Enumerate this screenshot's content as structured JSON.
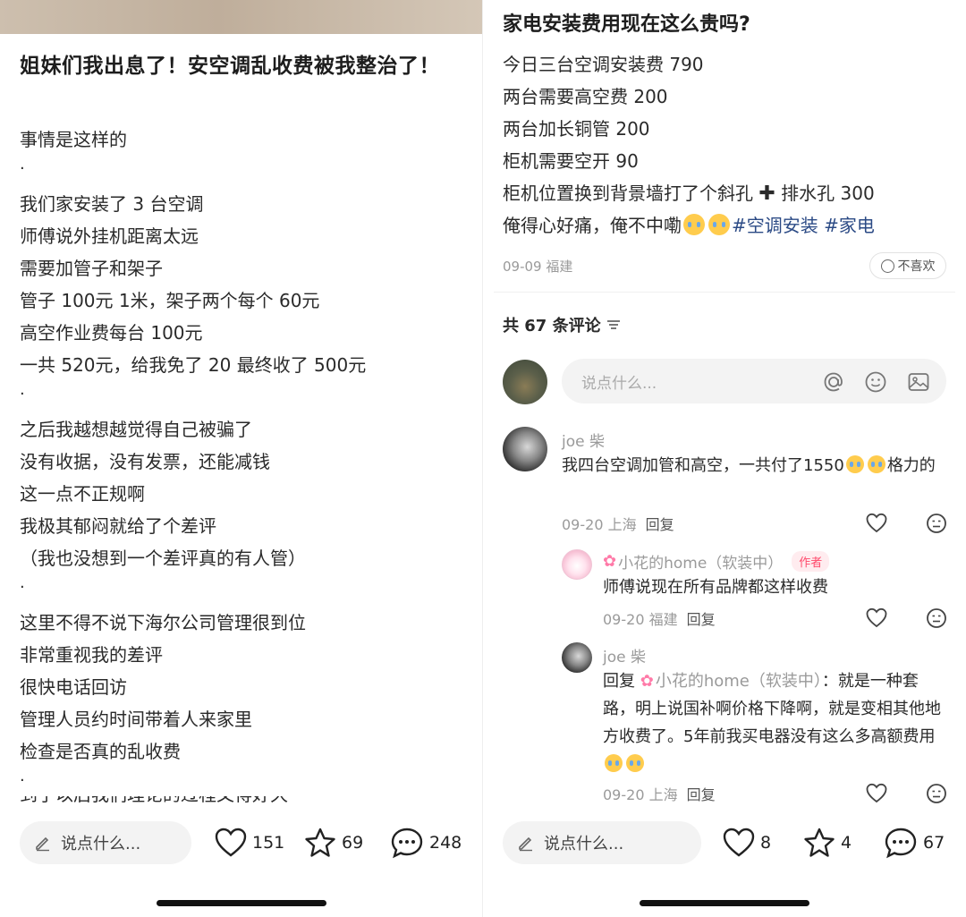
{
  "left": {
    "title": "姐妹们我出息了！安空调乱收费被我整治了！",
    "lines": [
      "事情是这样的",
      "·",
      "我们家安装了 3 台空调",
      "师傅说外挂机距离太远",
      "需要加管子和架子",
      "管子 100元 1米，架子两个每个 60元",
      "高空作业费每台 100元",
      "一共 520元，给我免了 20 最终收了 500元",
      "·",
      "之后我越想越觉得自己被骗了",
      "没有收据，没有发票，还能减钱",
      "这一点不正规啊",
      "我极其郁闷就给了个差评",
      "（我也没想到一个差评真的有人管）",
      "·",
      "这里不得不说下海尔公司管理很到位",
      "非常重视我的差评",
      "很快电话回访",
      "管理人员约时间带着人来家里",
      "检查是否真的乱收费",
      "·"
    ],
    "cut_line": "到了以后我们理论的过程又得好久",
    "bottom": {
      "comment_placeholder": "说点什么...",
      "likes": "151",
      "stars": "69",
      "comments": "248"
    }
  },
  "right": {
    "title": "家电安装费用现在这么贵吗?",
    "lines": [
      "今日三台空调安装费 790",
      "两台需要高空费 200",
      "两台加长铜管 200",
      "柜机需要空开 90"
    ],
    "line5_a": "柜机位置换到背景墙打了个斜孔",
    "line5_plus": "✚",
    "line5_b": "排水孔 300",
    "line6_text": "俺得心好痛，俺不中嘞",
    "hashtag1": "#空调安装",
    "hashtag2": "#家电",
    "post_meta": "09-09 福建",
    "dislike_label": "不喜欢",
    "comment_count": "共 67 条评论",
    "sort_icon": "sort-icon",
    "input_placeholder": "说点什么...",
    "comments": [
      {
        "name": "joe 柴",
        "text_a": "我四台空调加管和高空，一共付了1550",
        "text_b": "格力的",
        "meta": "09-20 上海",
        "reply": "回复"
      },
      {
        "name": "小花的home（软装中）",
        "tag": "作者",
        "text": "师傅说现在所有品牌都这样收费",
        "meta": "09-20 福建",
        "reply": "回复"
      },
      {
        "name": "joe 柴",
        "reply_prefix": "回复",
        "reply_to": "小花的home（软装中）",
        "text_a": "：就是一种套路，明上说国补啊价格下降啊，就是变相其他地方收费了。5年前我买电器没有这么多高额费用",
        "meta": "09-20 上海",
        "reply": "回复"
      }
    ],
    "bottom": {
      "comment_placeholder": "说点什么...",
      "likes": "8",
      "stars": "4",
      "comments": "67"
    }
  },
  "colors": {
    "hashtag": "#2b4a85",
    "author_tag": "#ff4a6b",
    "muted": "#9a9a9a"
  }
}
